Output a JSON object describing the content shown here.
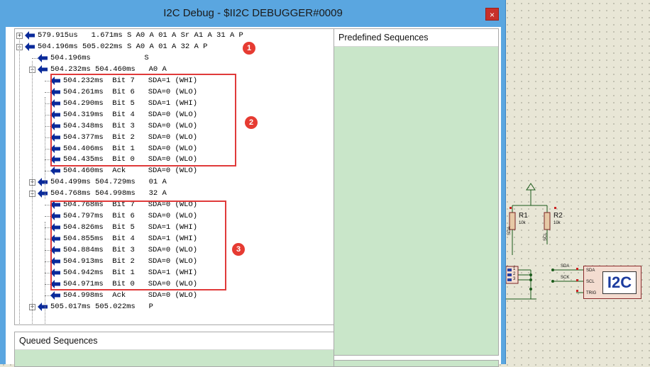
{
  "window": {
    "title": "I2C Debug - $II2C DEBUGGER#0009",
    "close_glyph": "×"
  },
  "tree": {
    "rows": [
      {
        "text": "579.915us   1.671ms S A0 A 01 A Sr A1 A 31 A P",
        "expander": "+"
      },
      {
        "text": "504.196ms 505.022ms S A0 A 01 A 32 A P",
        "expander": "−"
      },
      {
        "text": "504.196ms            S",
        "expander": ""
      },
      {
        "text": "504.232ms 504.460ms   A0 A",
        "expander": "−"
      },
      {
        "text": "504.232ms  Bit 7   SDA=1 (WHI)",
        "expander": ""
      },
      {
        "text": "504.261ms  Bit 6   SDA=0 (WLO)",
        "expander": ""
      },
      {
        "text": "504.290ms  Bit 5   SDA=1 (WHI)",
        "expander": ""
      },
      {
        "text": "504.319ms  Bit 4   SDA=0 (WLO)",
        "expander": ""
      },
      {
        "text": "504.348ms  Bit 3   SDA=0 (WLO)",
        "expander": ""
      },
      {
        "text": "504.377ms  Bit 2   SDA=0 (WLO)",
        "expander": ""
      },
      {
        "text": "504.406ms  Bit 1   SDA=0 (WLO)",
        "expander": ""
      },
      {
        "text": "504.435ms  Bit 0   SDA=0 (WLO)",
        "expander": ""
      },
      {
        "text": "504.460ms  Ack     SDA=0 (WLO)",
        "expander": ""
      },
      {
        "text": "504.499ms 504.729ms   01 A",
        "expander": "+"
      },
      {
        "text": "504.768ms 504.998ms   32 A",
        "expander": "−"
      },
      {
        "text": "504.768ms  Bit 7   SDA=0 (WLO)",
        "expander": ""
      },
      {
        "text": "504.797ms  Bit 6   SDA=0 (WLO)",
        "expander": ""
      },
      {
        "text": "504.826ms  Bit 5   SDA=1 (WHI)",
        "expander": ""
      },
      {
        "text": "504.855ms  Bit 4   SDA=1 (WHI)",
        "expander": ""
      },
      {
        "text": "504.884ms  Bit 3   SDA=0 (WLO)",
        "expander": ""
      },
      {
        "text": "504.913ms  Bit 2   SDA=0 (WLO)",
        "expander": ""
      },
      {
        "text": "504.942ms  Bit 1   SDA=1 (WHI)",
        "expander": ""
      },
      {
        "text": "504.971ms  Bit 0   SDA=0 (WLO)",
        "expander": ""
      },
      {
        "text": "504.998ms  Ack     SDA=0 (WLO)",
        "expander": ""
      },
      {
        "text": "505.017ms 505.022ms   P",
        "expander": "+"
      }
    ]
  },
  "callouts": {
    "badge_1": "1",
    "badge_2": "2",
    "badge_3": "3"
  },
  "panes": {
    "predefined_title": "Predefined Sequences",
    "queued_title": "Queued Sequences"
  },
  "schematic": {
    "r1_name": "R1",
    "r1_value": "10k",
    "r2_name": "R2",
    "r2_value": "10k",
    "r1_net": "SDA",
    "r2_net": "SCL",
    "conn_pin1": "1",
    "conn_pin2": "2",
    "conn_pin3": "3",
    "wire_sda": "SDA",
    "wire_sck": "SCK",
    "pin_sda": "SDA",
    "pin_scl": "SCL",
    "pin_trig": "TRIG",
    "chip_label": "I2C"
  },
  "colors": {
    "titlebar": "#5aa6e0",
    "close_button": "#c8302a",
    "callout": "#e03a3a",
    "pane_background": "#c9e6c9",
    "arrow": "#0a2a9a"
  }
}
